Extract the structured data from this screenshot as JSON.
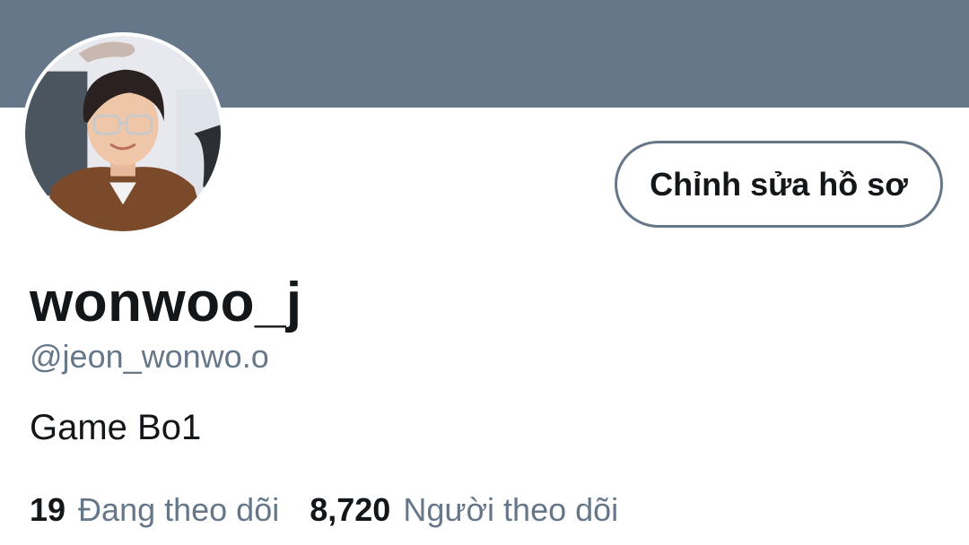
{
  "profile": {
    "display_name": "wonwoo_j",
    "handle": "@jeon_wonwo.o",
    "bio": "Game Bo1",
    "edit_button_label": "Chỉnh sửa hồ sơ"
  },
  "stats": {
    "following_count": "19",
    "following_label": "Đang theo dõi",
    "followers_count": "8,720",
    "followers_label": "Người theo dõi"
  },
  "colors": {
    "banner": "#66778a",
    "secondary_text": "#66778a",
    "primary_text": "#14171a"
  }
}
